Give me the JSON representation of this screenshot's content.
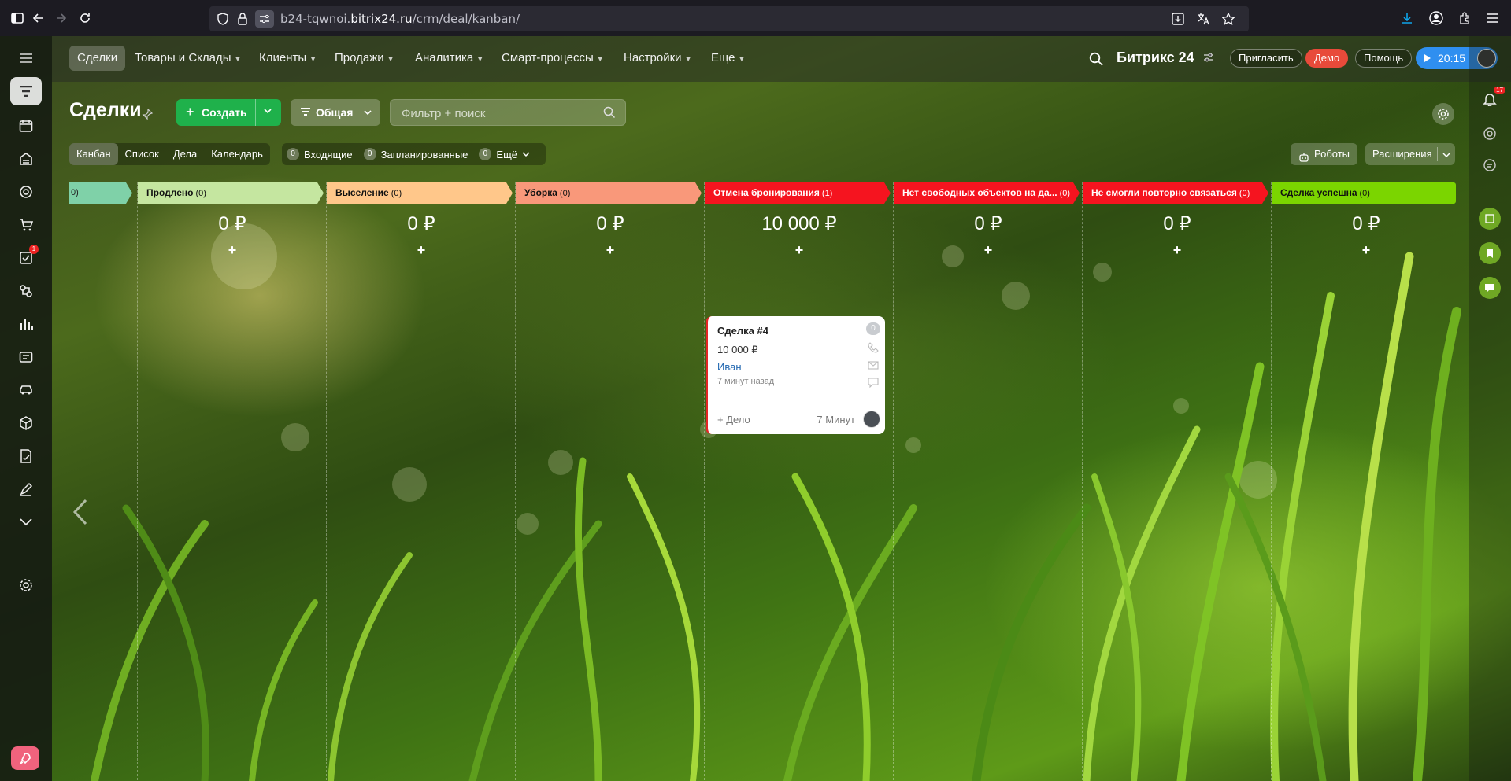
{
  "browser": {
    "url_prefix": "b24-tqwnoi.",
    "url_domain": "bitrix24.ru",
    "url_path": "/crm/deal/kanban/"
  },
  "topnav": {
    "items": [
      {
        "label": "Сделки",
        "active": true
      },
      {
        "label": "Товары и Склады"
      },
      {
        "label": "Клиенты"
      },
      {
        "label": "Продажи"
      },
      {
        "label": "Аналитика"
      },
      {
        "label": "Смарт-процессы"
      },
      {
        "label": "Настройки"
      },
      {
        "label": "Еще"
      }
    ],
    "brand": "Битрикс 24",
    "invite_label": "Пригласить",
    "demo_label": "Демо",
    "help_label": "Помощь",
    "time_label": "20:15"
  },
  "page": {
    "title": "Сделки",
    "create_label": "Создать",
    "category_label": "Общая",
    "search_placeholder": "Фильтр + поиск",
    "robots_label": "Роботы",
    "extensions_label": "Расширения"
  },
  "view_tabs": [
    "Канбан",
    "Список",
    "Дела",
    "Календарь"
  ],
  "counters": [
    {
      "count": "0",
      "label": "Входящие"
    },
    {
      "count": "0",
      "label": "Запланированные"
    },
    {
      "count": "0",
      "label": "Ещё"
    }
  ],
  "sidebar": {
    "tasks_badge": "1"
  },
  "right_rail": {
    "notifications_badge": "17"
  },
  "kanban": {
    "partial_column_count": "0)",
    "columns": [
      {
        "title": "Продлено",
        "count": "(0)",
        "sum": "0 ₽",
        "color": "#c5e6a0"
      },
      {
        "title": "Выселение",
        "count": "(0)",
        "sum": "0 ₽",
        "color": "#ffc78a"
      },
      {
        "title": "Уборка",
        "count": "(0)",
        "sum": "0 ₽",
        "color": "#f9987a"
      },
      {
        "title": "Отмена бронирования",
        "count": "(1)",
        "sum": "10 000 ₽",
        "color": "#f5141f"
      },
      {
        "title": "Нет свободных объектов на да...",
        "count": "(0)",
        "sum": "0 ₽",
        "color": "#f5141f"
      },
      {
        "title": "Не смогли повторно связаться",
        "count": "(0)",
        "sum": "0 ₽",
        "color": "#f5141f"
      },
      {
        "title": "Сделка успешна",
        "count": "(0)",
        "sum": "0 ₽",
        "color": "#7bd500"
      }
    ],
    "add_label": "+"
  },
  "card": {
    "title": "Сделка #4",
    "sum": "10 000 ₽",
    "contact": "Иван",
    "ago": "7 минут назад",
    "activity_label": "+ Дело",
    "timer": "7 Минут",
    "count": "0"
  }
}
